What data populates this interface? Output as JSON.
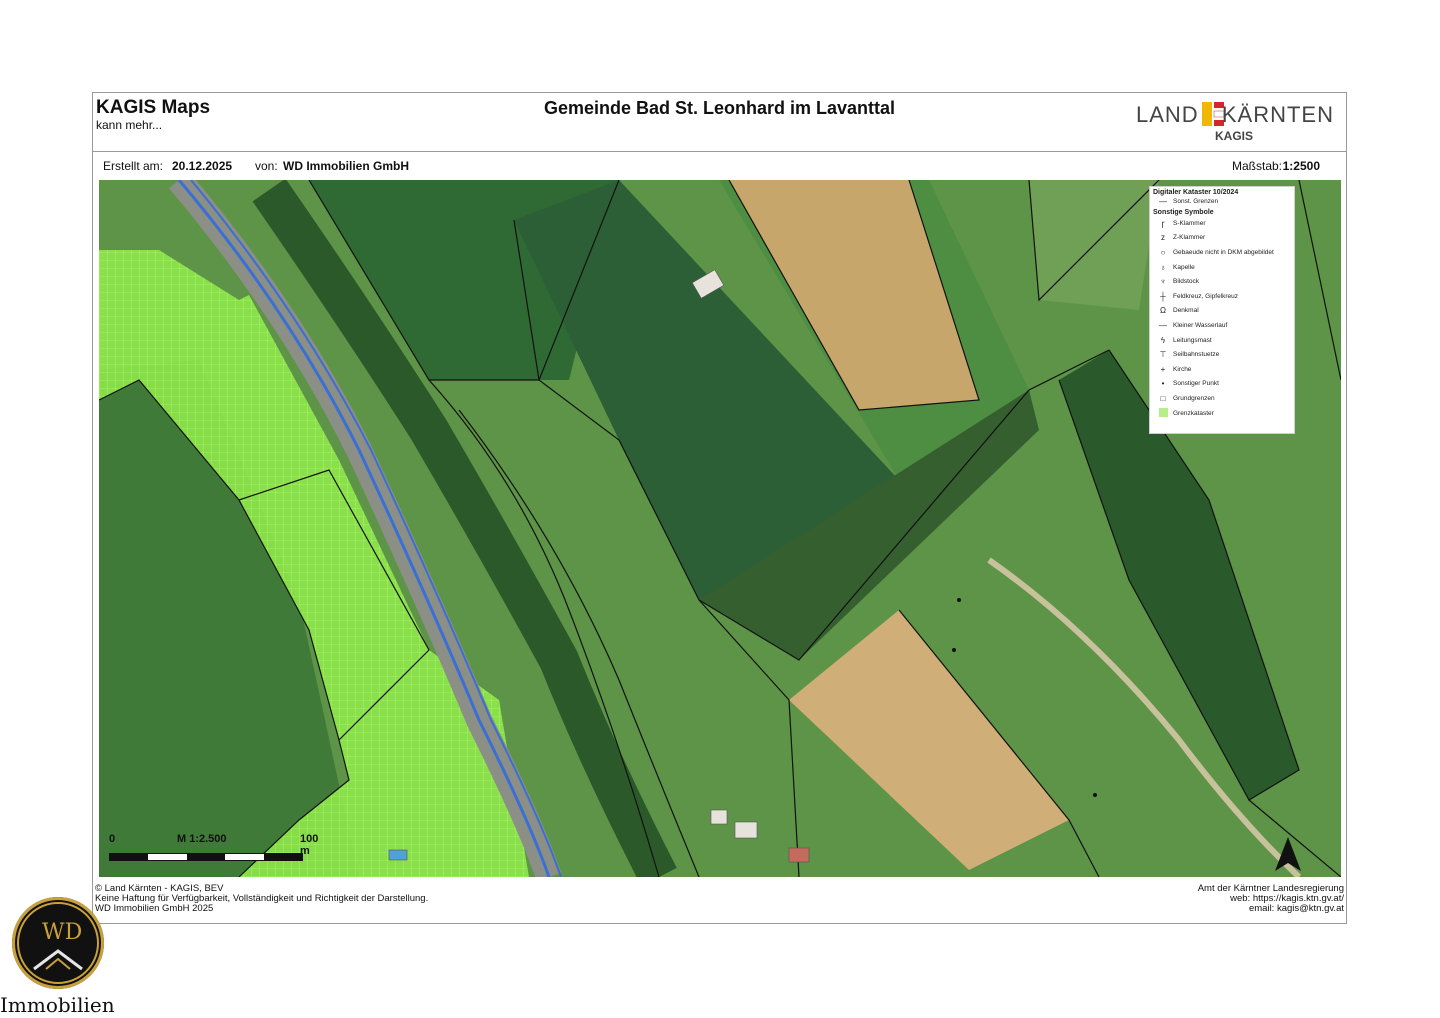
{
  "header": {
    "app_title": "KAGIS Maps",
    "app_subtitle": "kann mehr...",
    "page_title": "Gemeinde Bad St. Leonhard im Lavanttal",
    "logo_left": "LAND",
    "logo_right": "KÄRNTEN",
    "logo_sub": "KAGIS"
  },
  "meta": {
    "created_label": "Erstellt am:",
    "created_value": "20.12.2025",
    "by_label": "von:",
    "by_value": "WD Immobilien GmbH",
    "scale_label": "Maßstab:",
    "scale_value": "1:2500"
  },
  "legend": {
    "heading1": "Digitaler Kataster 10/2024",
    "item0": "Sonst. Grenzen",
    "heading2": "Sonstige Symbole",
    "items": [
      "S-Klammer",
      "Z-Klammer",
      "Gebaeude nicht in DKM abgebildet",
      "Kapelle",
      "Bildstock",
      "Feldkreuz, Gipfelkreuz",
      "Denkmal",
      "Kleiner Wasserlauf",
      "Leitungsmast",
      "Seilbahnstuetze",
      "Kirche",
      "Sonstiger Punkt",
      "Grundgrenzen",
      "Grenzkataster"
    ]
  },
  "scalebar": {
    "start": "0",
    "scale": "M 1:2.500",
    "end": "100 m"
  },
  "footer": {
    "left1": "© Land Kärnten - KAGIS, BEV",
    "left2": "Keine Haftung für Verfügbarkeit, Vollständigkeit und Richtigkeit der Darstellung.",
    "left3": "WD Immobilien GmbH 2025",
    "right1": "Amt der Kärntner Landesregierung",
    "right2": "web: https://kagis.ktn.gv.at/",
    "right3": "email: kagis@ktn.gv.at"
  },
  "brand": {
    "initials": "WD",
    "name": "Immobilien"
  },
  "colors": {
    "road": "#3a6fd6",
    "grenzkataster": "#8fe84a",
    "parcel_line": "#111111",
    "logo_red": "#d6262b",
    "logo_yellow": "#f2b705",
    "brand_gold": "#c9a13b"
  }
}
